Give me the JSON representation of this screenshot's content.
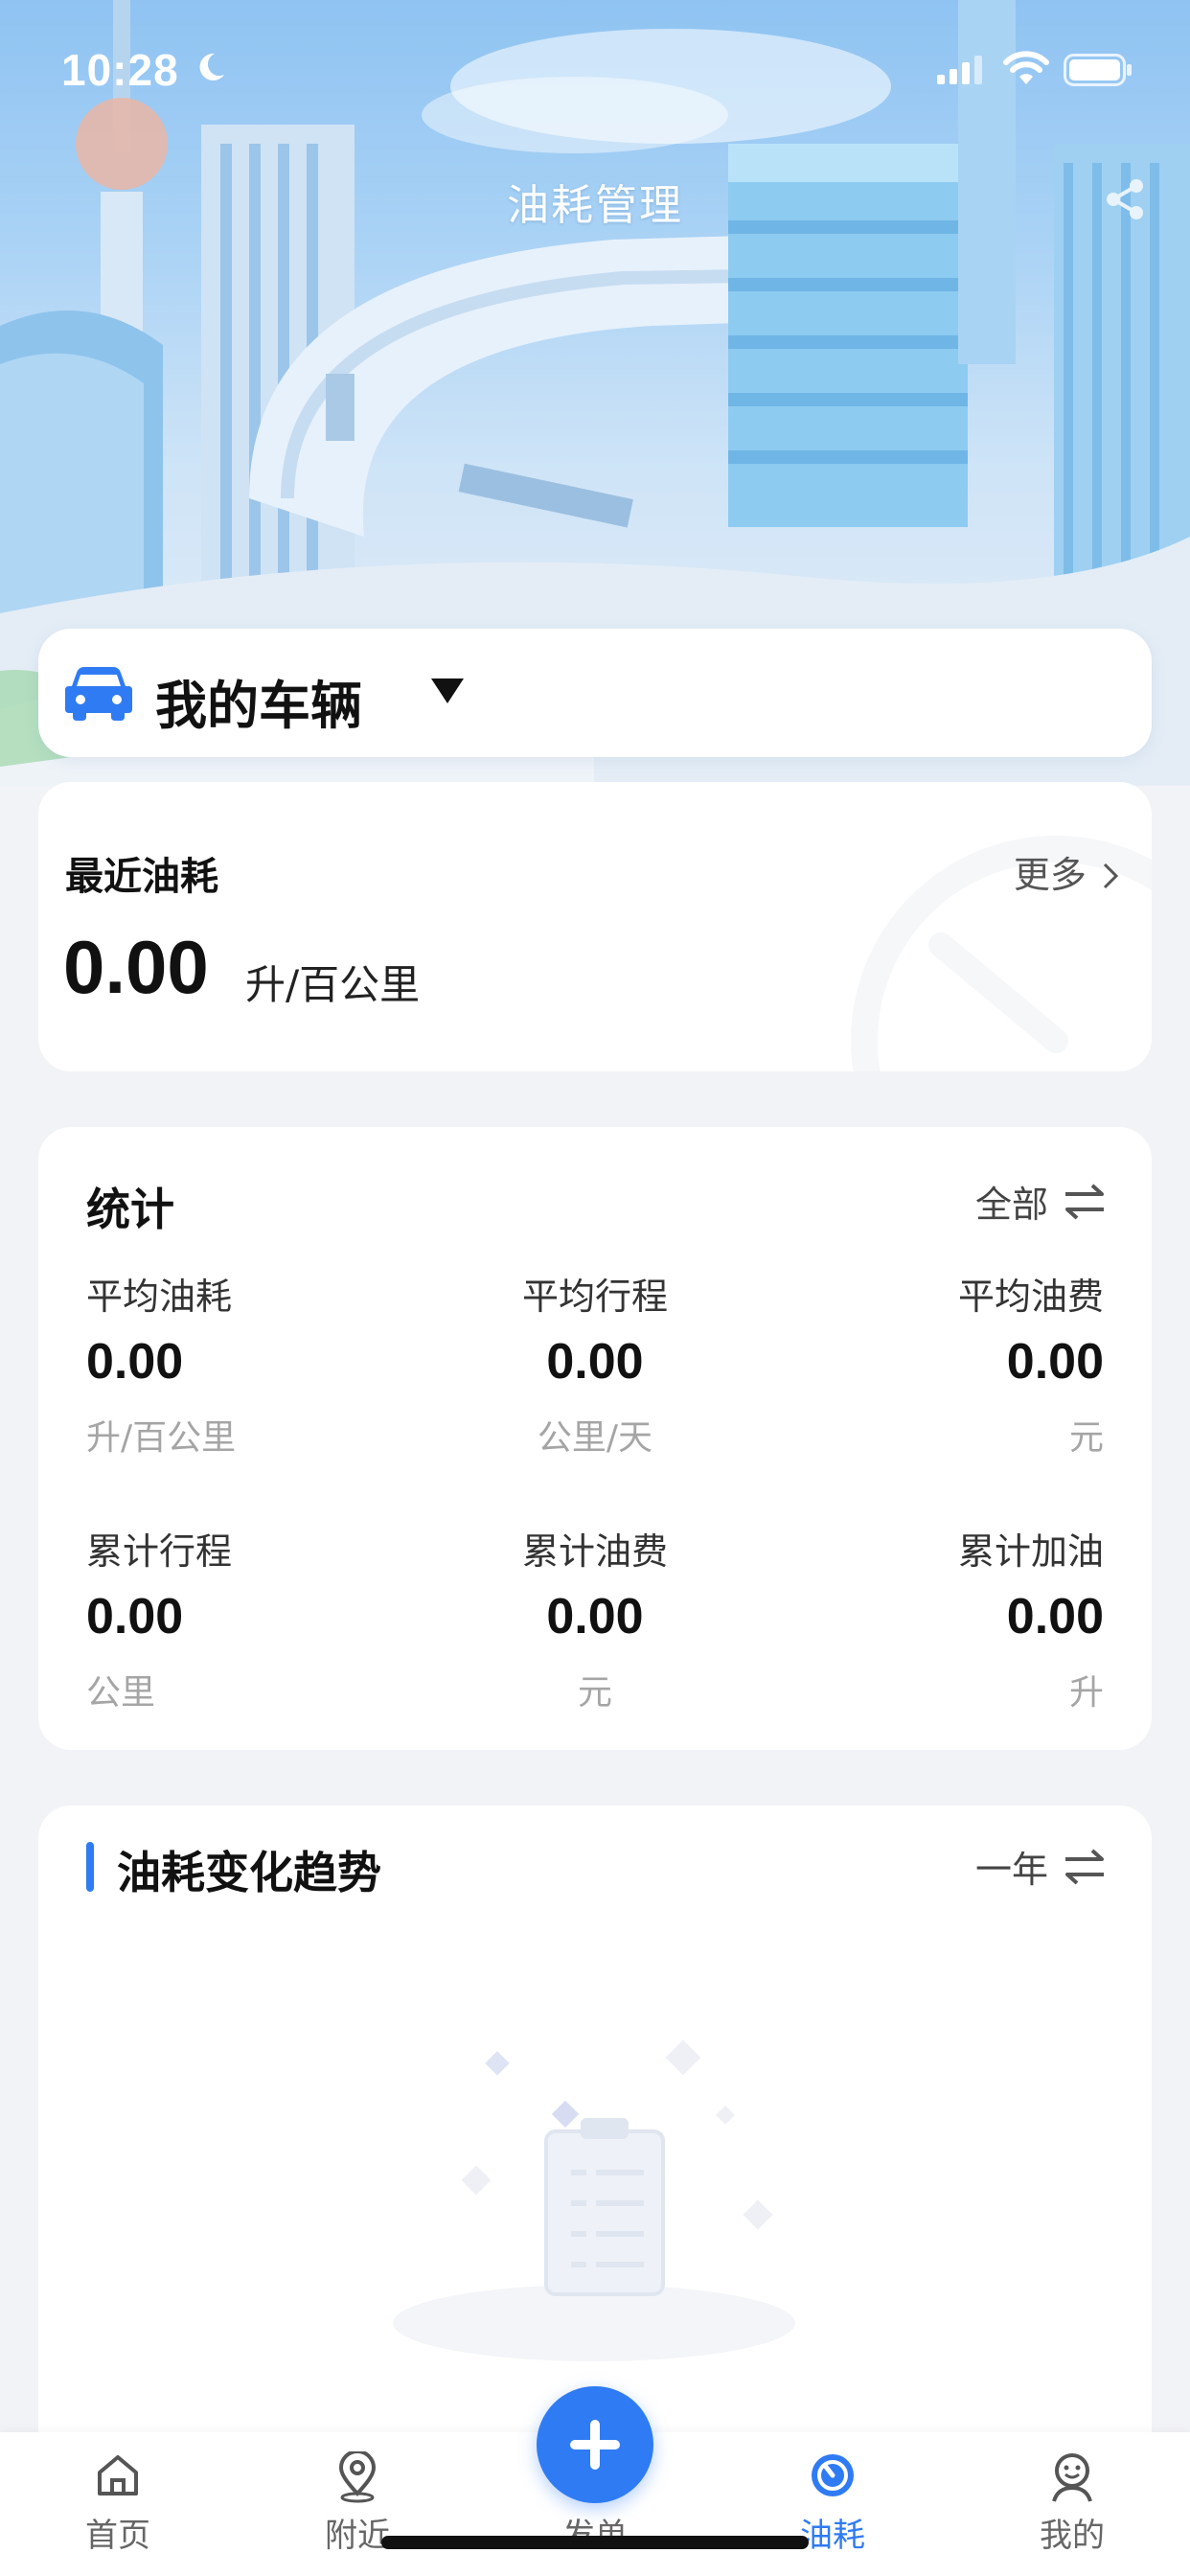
{
  "status_bar": {
    "time": "10:28"
  },
  "header": {
    "title": "油耗管理"
  },
  "vehicle": {
    "label": "我的车辆"
  },
  "recent": {
    "title": "最近油耗",
    "more": "更多",
    "value": "0.00",
    "unit": "升/百公里"
  },
  "stats": {
    "title": "统计",
    "range": "全部",
    "items": [
      {
        "label": "平均油耗",
        "value": "0.00",
        "unit": "升/百公里"
      },
      {
        "label": "平均行程",
        "value": "0.00",
        "unit": "公里/天"
      },
      {
        "label": "平均油费",
        "value": "0.00",
        "unit": "元"
      },
      {
        "label": "累计行程",
        "value": "0.00",
        "unit": "公里"
      },
      {
        "label": "累计油费",
        "value": "0.00",
        "unit": "元"
      },
      {
        "label": "累计加油",
        "value": "0.00",
        "unit": "升"
      }
    ]
  },
  "trend": {
    "title": "油耗变化趋势",
    "range": "一年"
  },
  "tabs": [
    {
      "label": "首页",
      "icon": "home-icon"
    },
    {
      "label": "附近",
      "icon": "location-icon"
    },
    {
      "label": "发单",
      "icon": "plus-icon"
    },
    {
      "label": "油耗",
      "icon": "fuel-gauge-icon"
    },
    {
      "label": "我的",
      "icon": "profile-icon"
    }
  ],
  "colors": {
    "accent": "#2f7bf3",
    "background": "#f2f3f7"
  }
}
